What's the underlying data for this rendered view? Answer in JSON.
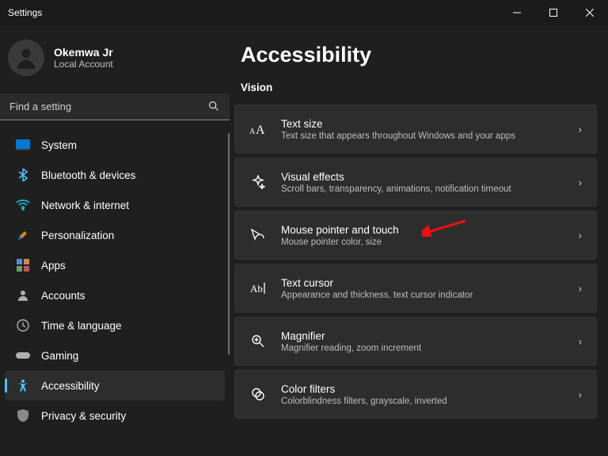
{
  "window": {
    "title": "Settings"
  },
  "user": {
    "name": "Okemwa Jr",
    "sub": "Local Account"
  },
  "search": {
    "placeholder": "Find a setting"
  },
  "nav": [
    {
      "label": "System"
    },
    {
      "label": "Bluetooth & devices"
    },
    {
      "label": "Network & internet"
    },
    {
      "label": "Personalization"
    },
    {
      "label": "Apps"
    },
    {
      "label": "Accounts"
    },
    {
      "label": "Time & language"
    },
    {
      "label": "Gaming"
    },
    {
      "label": "Accessibility"
    },
    {
      "label": "Privacy & security"
    }
  ],
  "page": {
    "title": "Accessibility",
    "section": "Vision"
  },
  "cards": [
    {
      "title": "Text size",
      "sub": "Text size that appears throughout Windows and your apps"
    },
    {
      "title": "Visual effects",
      "sub": "Scroll bars, transparency, animations, notification timeout"
    },
    {
      "title": "Mouse pointer and touch",
      "sub": "Mouse pointer color, size"
    },
    {
      "title": "Text cursor",
      "sub": "Appearance and thickness, text cursor indicator"
    },
    {
      "title": "Magnifier",
      "sub": "Magnifier reading, zoom increment"
    },
    {
      "title": "Color filters",
      "sub": "Colorblindness filters, grayscale, inverted"
    }
  ]
}
